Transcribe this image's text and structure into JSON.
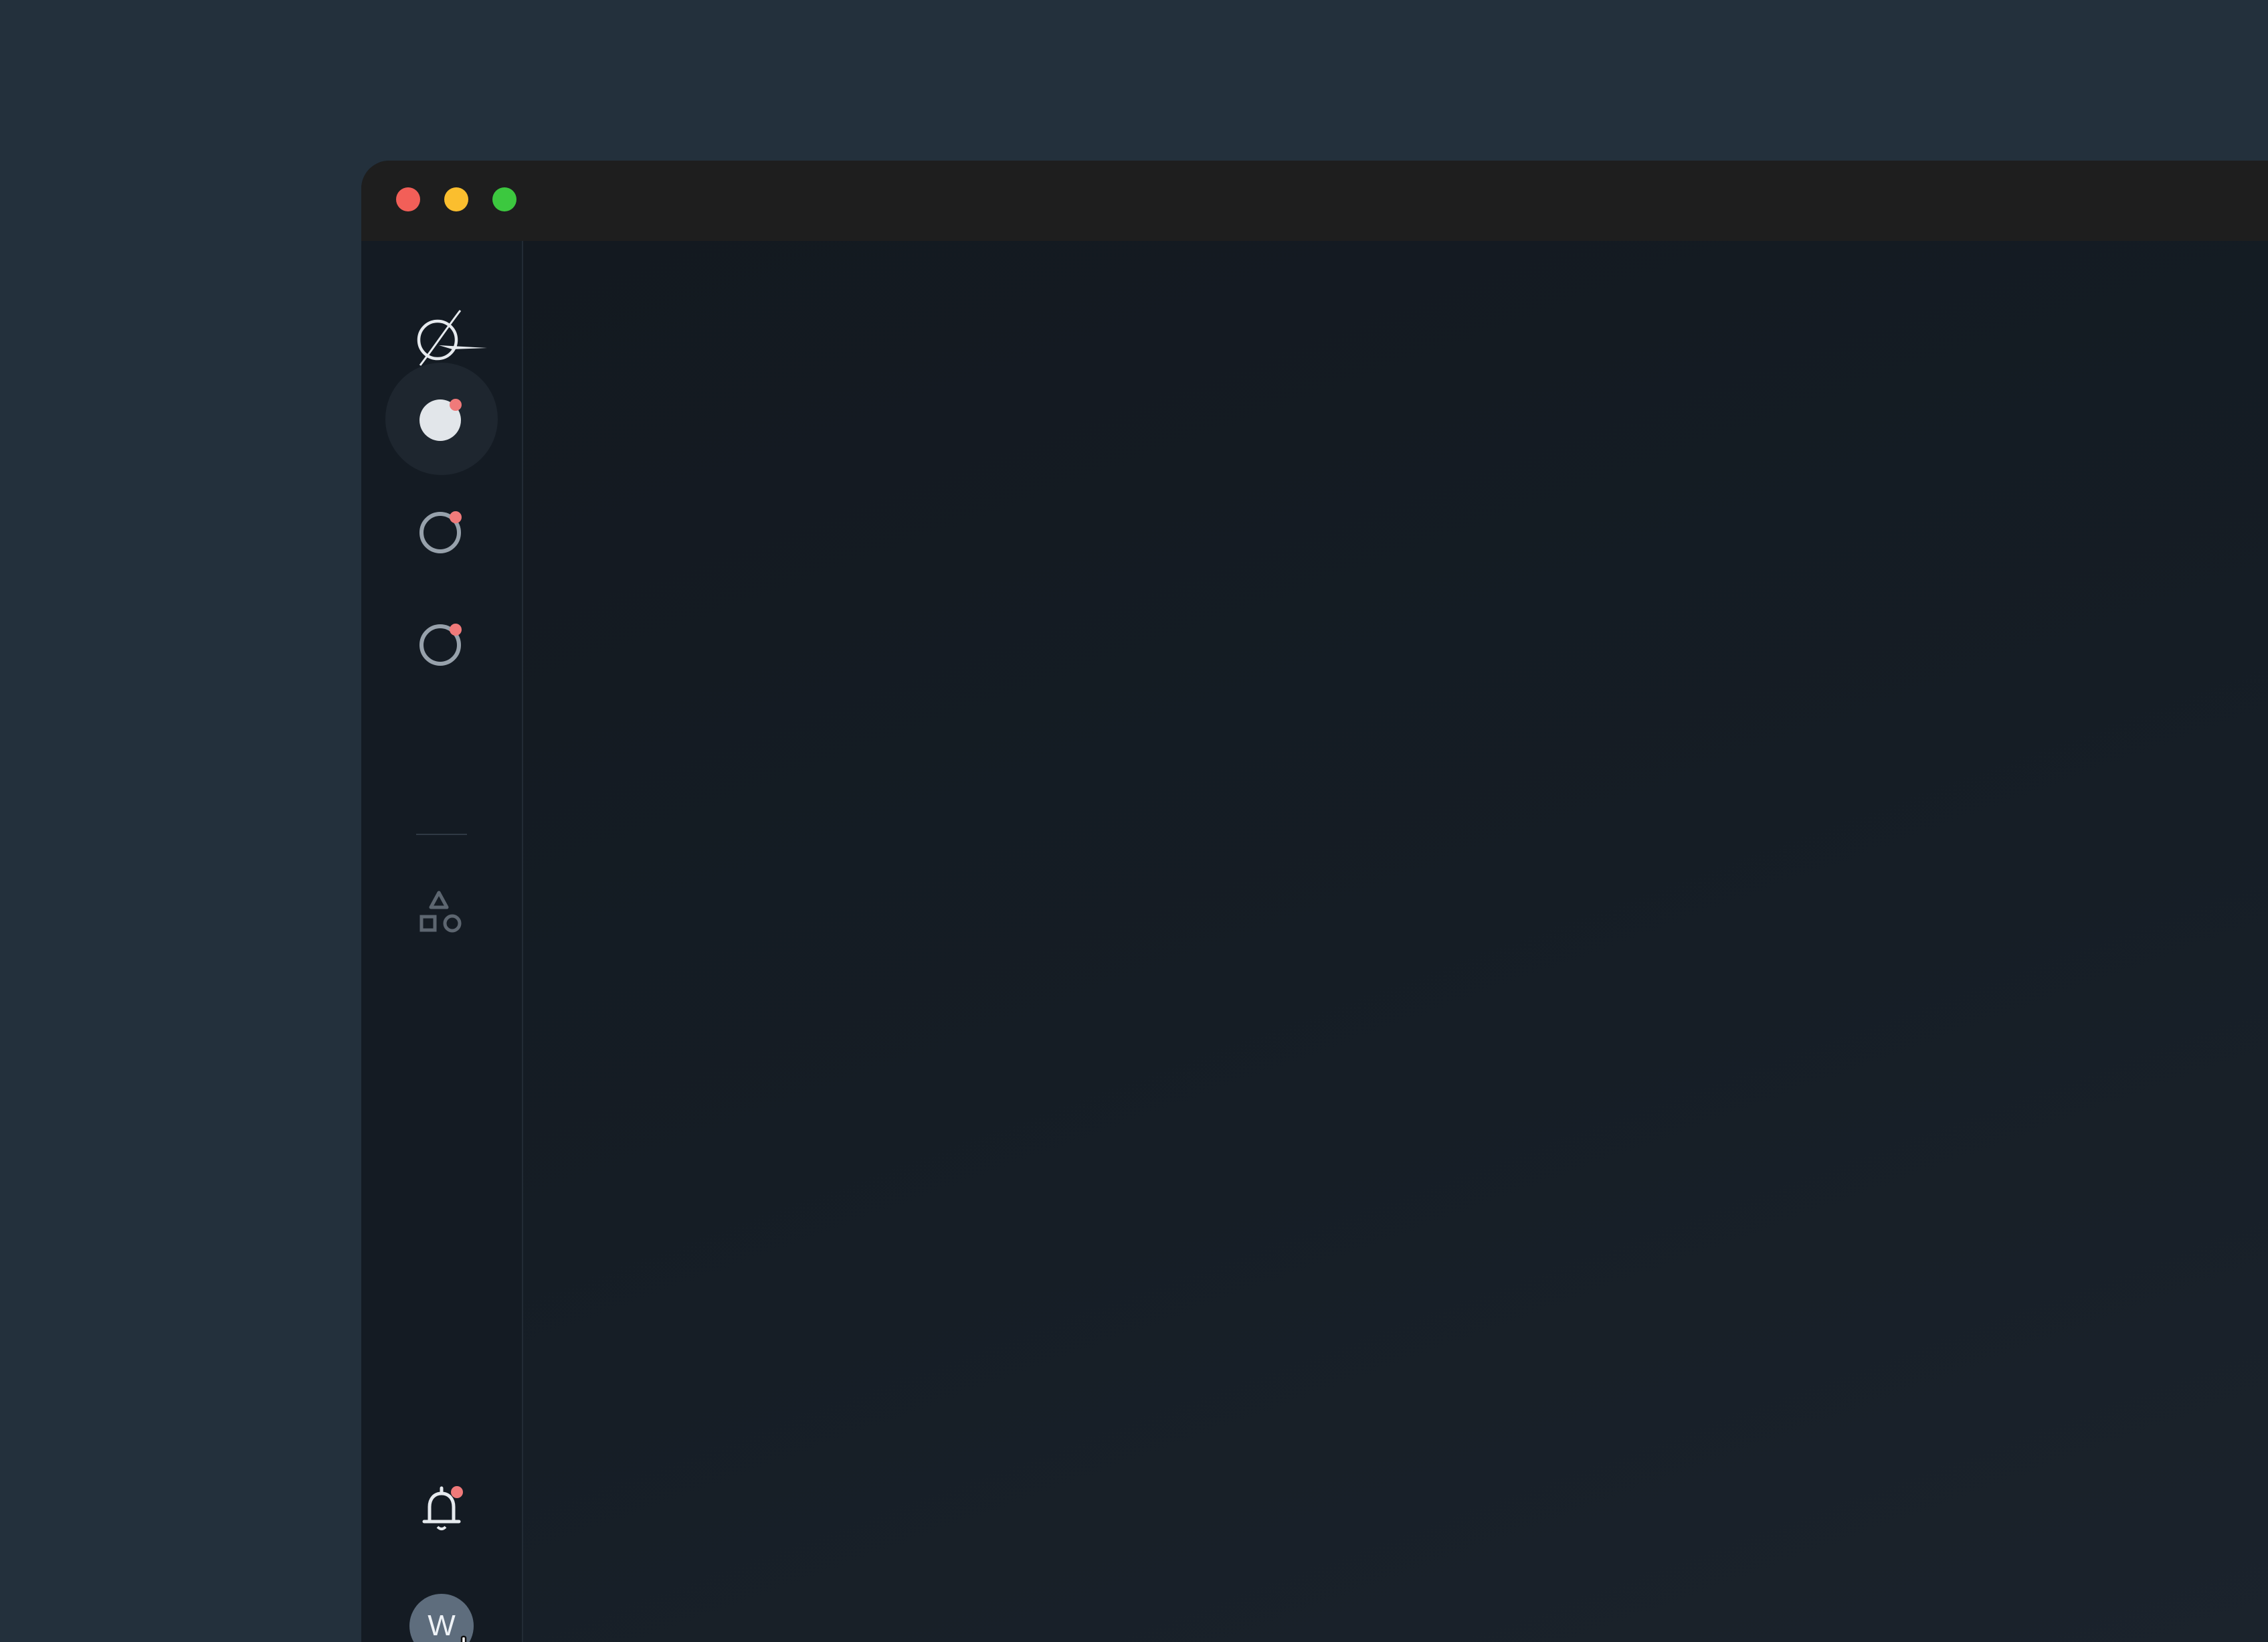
{
  "window": {
    "traffic_lights": {
      "close_color": "#f25f58",
      "minimize_color": "#fbbe2e",
      "maximize_color": "#3cc83f"
    }
  },
  "sidebar": {
    "logo": "orbital-swoosh-logo",
    "nav_items": [
      {
        "icon": "filled-circle-icon",
        "active": true,
        "has_badge": true
      },
      {
        "icon": "outline-circle-icon",
        "active": false,
        "has_badge": true
      },
      {
        "icon": "outline-circle-icon",
        "active": false,
        "has_badge": true
      }
    ],
    "apps_icon": "shapes-icon",
    "notifications": {
      "icon": "bell-icon",
      "has_badge": true
    },
    "avatar": {
      "initial": "W"
    }
  },
  "colors": {
    "badge": "#f07a7a",
    "icon_active": "#e2e6ea",
    "icon_inactive": "#97a1ab",
    "icon_muted": "#5d6670",
    "avatar_bg": "#5e6d7d"
  }
}
